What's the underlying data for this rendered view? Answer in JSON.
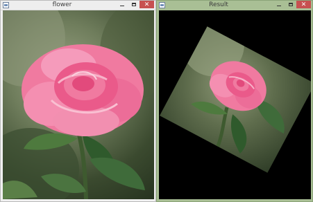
{
  "windows": {
    "flower": {
      "title": "flower"
    },
    "result": {
      "title": "Result"
    }
  },
  "controls": {
    "minimize": "–",
    "maximize": "□",
    "close": "✕"
  },
  "icons": {
    "app": "window-app-icon",
    "minimize": "minimize-icon",
    "maximize": "maximize-icon",
    "close": "close-icon"
  },
  "colors": {
    "result_frame": "#a9bf95",
    "close_button": "#c75050",
    "rose_pink": "#f07aa0",
    "leaf_green": "#3f6b3a"
  }
}
